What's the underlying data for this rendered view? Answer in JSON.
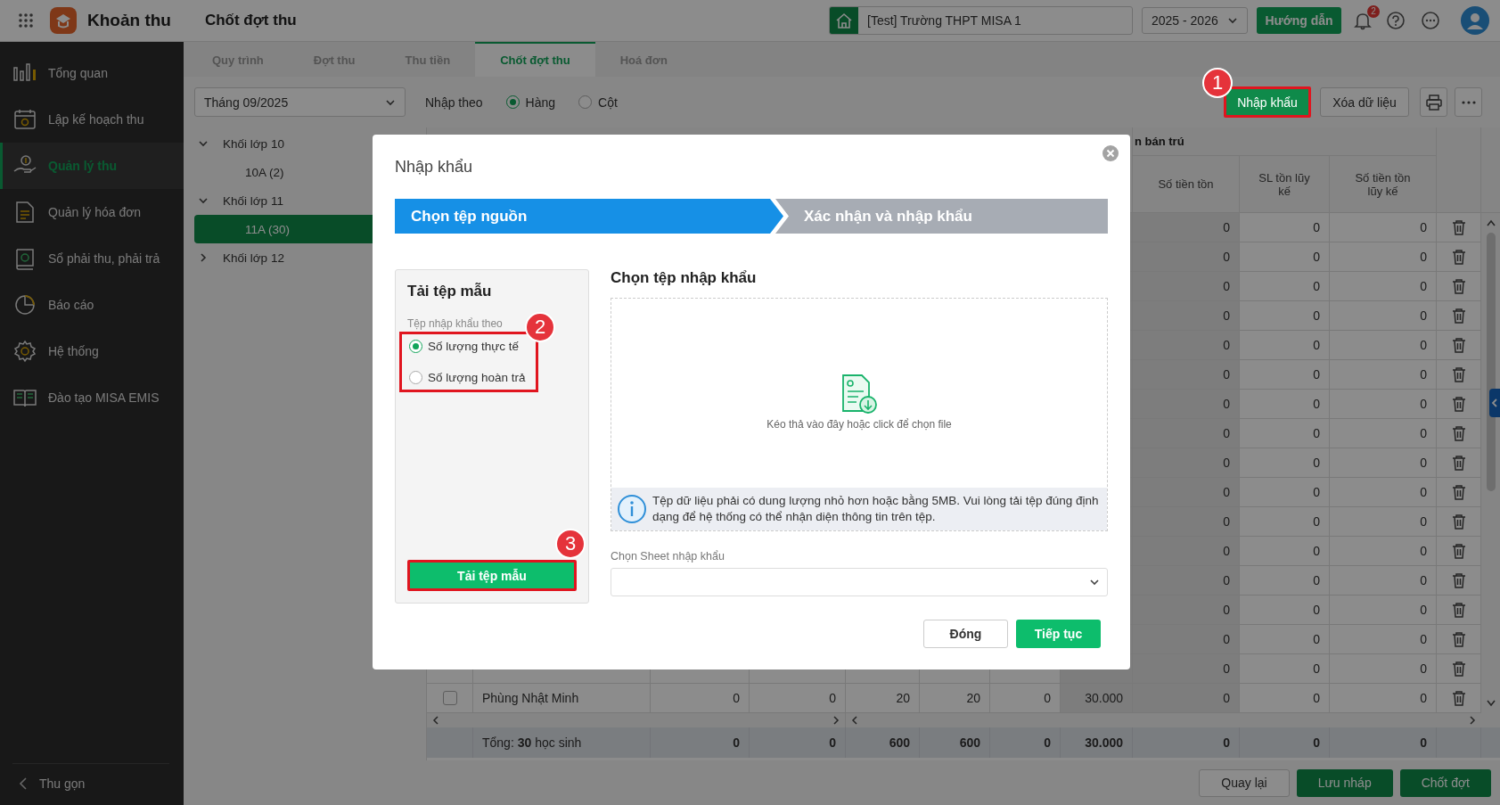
{
  "topbar": {
    "app_name": "Khoản thu",
    "page_title": "Chốt đợt thu",
    "school": "[Test] Trường THPT MISA 1",
    "year": "2025 - 2026",
    "guide_button": "Hướng dẫn",
    "notification_count": "2"
  },
  "sidebar": {
    "items": [
      {
        "label": "Tổng quan",
        "kind": "chart",
        "selected": false
      },
      {
        "label": "Lập kế hoạch thu",
        "kind": "plan",
        "selected": false
      },
      {
        "label": "Quản lý thu",
        "kind": "collect",
        "selected": true
      },
      {
        "label": "Quản lý hóa đơn",
        "kind": "invoice",
        "selected": false
      },
      {
        "label": "Sổ phải thu, phải trả",
        "kind": "ledger",
        "selected": false
      },
      {
        "label": "Báo cáo",
        "kind": "report",
        "selected": false
      },
      {
        "label": "Hệ thống",
        "kind": "system",
        "selected": false
      },
      {
        "label": "Đào tạo MISA EMIS",
        "kind": "training",
        "selected": false
      }
    ],
    "collapse": "Thu gọn"
  },
  "tabs": [
    {
      "label": "Quy trình",
      "selected": false
    },
    {
      "label": "Đợt thu",
      "selected": false
    },
    {
      "label": "Thu tiền",
      "selected": false
    },
    {
      "label": "Chốt đợt thu",
      "selected": true
    },
    {
      "label": "Hoá đơn",
      "selected": false
    }
  ],
  "toolbar": {
    "month": "Tháng 09/2025",
    "input_by_label": "Nhập theo",
    "input_by_options": [
      {
        "label": "Hàng",
        "selected": true
      },
      {
        "label": "Cột",
        "selected": false
      }
    ],
    "import_button": {
      "label": "Nhập khẩu",
      "callout": "1"
    },
    "clear_button": "Xóa dữ liệu"
  },
  "tree": [
    {
      "label": "Khối lớp 10",
      "expanded": true,
      "selected": false,
      "children": [
        {
          "label": "10A (2)",
          "selected": false
        }
      ]
    },
    {
      "label": "Khối lớp 11",
      "expanded": true,
      "selected": false,
      "children": [
        {
          "label": "11A (30)",
          "selected": true
        }
      ]
    },
    {
      "label": "Khối lớp 12",
      "expanded": false,
      "selected": false
    }
  ],
  "table": {
    "group_header": "n bán trú",
    "headers": [
      "Số tiền tồn",
      "SL tồn lũy kế",
      "Số tiền tồn lũy kế"
    ],
    "rows": [
      {
        "values": [
          "0",
          "0",
          "0"
        ]
      },
      {
        "values": [
          "0",
          "0",
          "0"
        ]
      },
      {
        "values": [
          "0",
          "0",
          "0"
        ]
      },
      {
        "values": [
          "0",
          "0",
          "0"
        ]
      },
      {
        "values": [
          "0",
          "0",
          "0"
        ]
      },
      {
        "values": [
          "0",
          "0",
          "0"
        ]
      },
      {
        "values": [
          "0",
          "0",
          "0"
        ]
      },
      {
        "values": [
          "0",
          "0",
          "0"
        ]
      },
      {
        "values": [
          "0",
          "0",
          "0"
        ]
      },
      {
        "values": [
          "0",
          "0",
          "0"
        ]
      },
      {
        "values": [
          "0",
          "0",
          "0"
        ]
      },
      {
        "values": [
          "0",
          "0",
          "0"
        ]
      },
      {
        "values": [
          "0",
          "0",
          "0"
        ]
      },
      {
        "values": [
          "0",
          "0",
          "0"
        ]
      },
      {
        "values": [
          "0",
          "0",
          "0"
        ]
      },
      {
        "values": [
          "0",
          "0",
          "0"
        ]
      },
      {
        "name": "Phùng Nhật Minh",
        "checked": false,
        "values": [
          "0",
          "0",
          "20",
          "20",
          "0",
          "30.000",
          "0",
          "0",
          "0"
        ]
      }
    ],
    "total": {
      "label": "Tổng: **30** học sinh",
      "values": [
        "0",
        "0",
        "600",
        "600",
        "0",
        "30.000",
        "0",
        "0",
        "0"
      ]
    }
  },
  "footer_buttons": [
    {
      "label": "Quay lại",
      "kind": "secondary"
    },
    {
      "label": "Lưu nháp",
      "kind": "primary"
    },
    {
      "label": "Chốt đợt",
      "kind": "primary"
    }
  ],
  "dialog": {
    "title": "Nhập khẩu",
    "steps": [
      {
        "label": "Chọn tệp nguồn",
        "selected": true
      },
      {
        "label": "Xác nhận và nhập khẩu",
        "selected": false
      }
    ],
    "template_panel": {
      "title": "Tải tệp mẫu",
      "option_label": "Tệp nhập khẩu theo",
      "options_callout": "2",
      "options": [
        {
          "label": "Số lượng thực tế",
          "selected": true
        },
        {
          "label": "Số lượng hoàn trả",
          "selected": false
        }
      ],
      "download_button": {
        "label": "Tải tệp mẫu",
        "callout": "3"
      }
    },
    "file_panel": {
      "title": "Chọn tệp nhập khẩu",
      "drop_hint": "Kéo thả vào đây hoặc click để chọn file",
      "info": "Tệp dữ liệu phải có dung lượng nhỏ hơn hoặc bằng 5MB. Vui lòng tải tệp đúng định dạng để hệ thống có thể nhận diện thông tin trên tệp.",
      "sheet_label": "Chọn Sheet nhập khẩu"
    },
    "buttons": [
      {
        "label": "Đóng",
        "kind": "secondary"
      },
      {
        "label": "Tiếp tục",
        "kind": "primary"
      }
    ]
  }
}
